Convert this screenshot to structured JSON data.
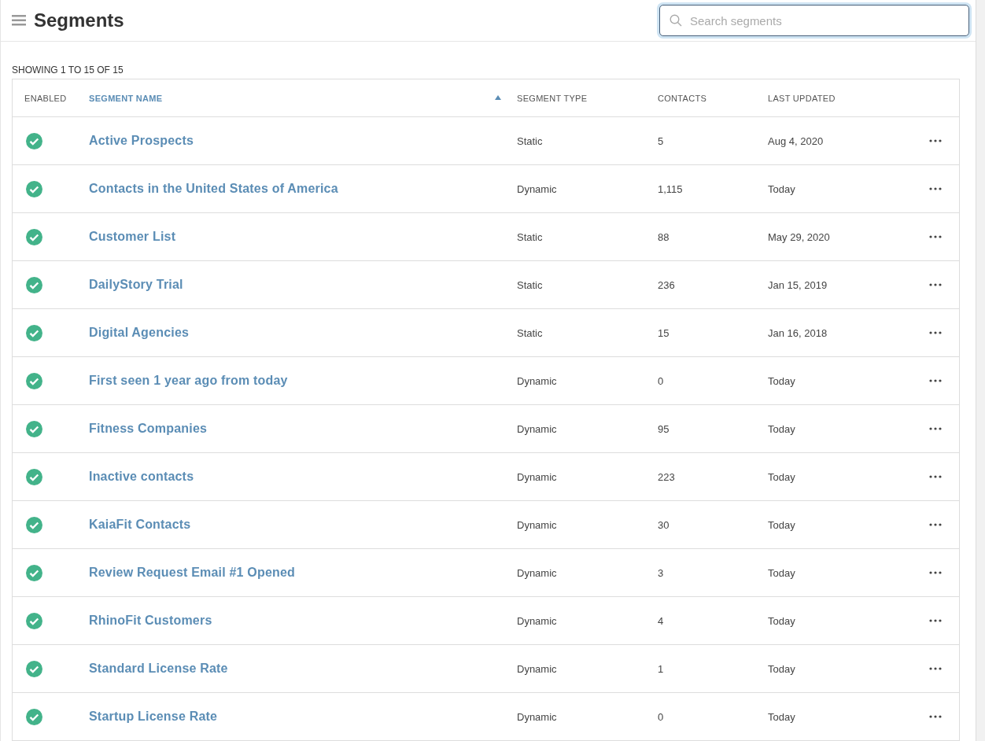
{
  "header": {
    "title": "Segments",
    "search": {
      "placeholder": "Search segments",
      "focused": true
    }
  },
  "summary": "SHOWING 1 TO 15 OF 15",
  "table": {
    "columns": [
      {
        "label": "ENABLED",
        "sorted": false
      },
      {
        "label": "SEGMENT NAME",
        "sorted": true
      },
      {
        "label": "SEGMENT TYPE",
        "sorted": false
      },
      {
        "label": "CONTACTS",
        "sorted": false
      },
      {
        "label": "LAST UPDATED",
        "sorted": false
      }
    ],
    "rows": [
      {
        "enabled": true,
        "name": "Active Prospects",
        "type": "Static",
        "contacts": "5",
        "updated": "Aug 4, 2020"
      },
      {
        "enabled": true,
        "name": "Contacts in the United States of America",
        "type": "Dynamic",
        "contacts": "1,115",
        "updated": "Today"
      },
      {
        "enabled": true,
        "name": "Customer List",
        "type": "Static",
        "contacts": "88",
        "updated": "May 29, 2020"
      },
      {
        "enabled": true,
        "name": "DailyStory Trial",
        "type": "Static",
        "contacts": "236",
        "updated": "Jan 15, 2019"
      },
      {
        "enabled": true,
        "name": "Digital Agencies",
        "type": "Static",
        "contacts": "15",
        "updated": "Jan 16, 2018"
      },
      {
        "enabled": true,
        "name": "First seen 1 year ago from today",
        "type": "Dynamic",
        "contacts": "0",
        "updated": "Today"
      },
      {
        "enabled": true,
        "name": "Fitness Companies",
        "type": "Dynamic",
        "contacts": "95",
        "updated": "Today"
      },
      {
        "enabled": true,
        "name": "Inactive contacts",
        "type": "Dynamic",
        "contacts": "223",
        "updated": "Today"
      },
      {
        "enabled": true,
        "name": "KaiaFit Contacts",
        "type": "Dynamic",
        "contacts": "30",
        "updated": "Today"
      },
      {
        "enabled": true,
        "name": "Review Request Email #1 Opened",
        "type": "Dynamic",
        "contacts": "3",
        "updated": "Today"
      },
      {
        "enabled": true,
        "name": "RhinoFit Customers",
        "type": "Dynamic",
        "contacts": "4",
        "updated": "Today"
      },
      {
        "enabled": true,
        "name": "Standard License Rate",
        "type": "Dynamic",
        "contacts": "1",
        "updated": "Today"
      },
      {
        "enabled": true,
        "name": "Startup License Rate",
        "type": "Dynamic",
        "contacts": "0",
        "updated": "Today"
      }
    ]
  }
}
